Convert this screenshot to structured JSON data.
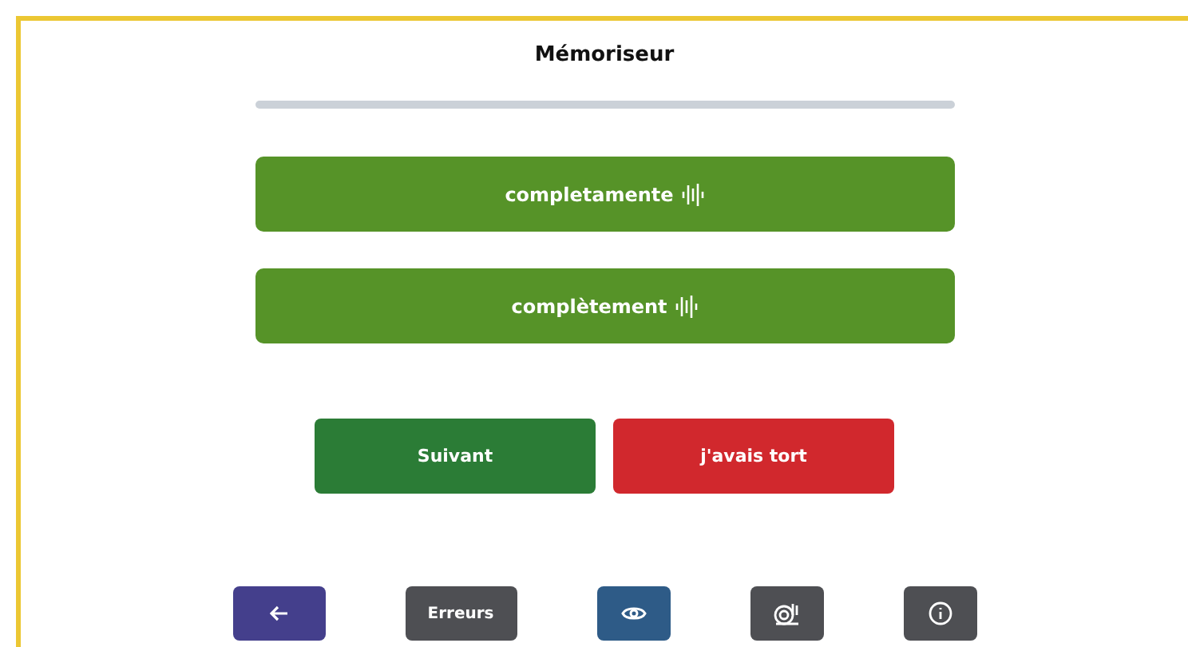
{
  "title": "Mémoriseur",
  "progress": {
    "level": 0
  },
  "answers": [
    {
      "label": "completamente"
    },
    {
      "label": "complètement"
    }
  ],
  "actions": [
    {
      "label": "Suivant",
      "kind": "next"
    },
    {
      "label": "j'avais tort",
      "kind": "wrong"
    }
  ],
  "toolbar": [
    {
      "kind": "back"
    },
    {
      "kind": "text",
      "label": "Erreurs"
    },
    {
      "kind": "eye"
    },
    {
      "kind": "snail"
    },
    {
      "kind": "info"
    }
  ]
}
